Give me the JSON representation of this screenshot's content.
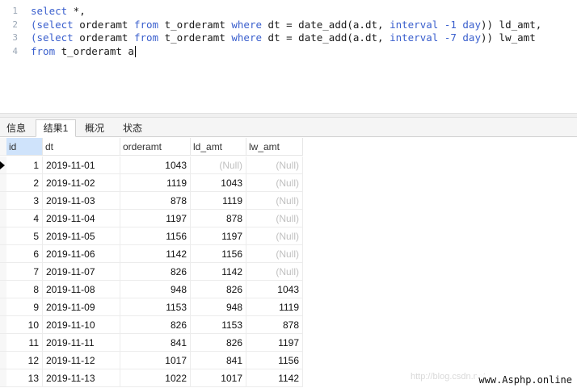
{
  "editor": {
    "line_numbers": [
      "1",
      "2",
      "3",
      "4"
    ],
    "lines": [
      [
        {
          "t": "select",
          "k": true
        },
        {
          "t": " *,",
          "k": false
        }
      ],
      [
        {
          "t": "(select",
          "k": true
        },
        {
          "t": " orderamt ",
          "k": false
        },
        {
          "t": "from",
          "k": true
        },
        {
          "t": " t_orderamt ",
          "k": false
        },
        {
          "t": "where",
          "k": true
        },
        {
          "t": " dt = date_add(a.dt, ",
          "k": false
        },
        {
          "t": "interval",
          "k": true
        },
        {
          "t": " ",
          "k": false
        },
        {
          "t": "-1",
          "k": true
        },
        {
          "t": " ",
          "k": false
        },
        {
          "t": "day",
          "k": true
        },
        {
          "t": ")) ld_amt,",
          "k": false
        }
      ],
      [
        {
          "t": "(select",
          "k": true
        },
        {
          "t": " orderamt ",
          "k": false
        },
        {
          "t": "from",
          "k": true
        },
        {
          "t": " t_orderamt ",
          "k": false
        },
        {
          "t": "where",
          "k": true
        },
        {
          "t": " dt = date_add(a.dt, ",
          "k": false
        },
        {
          "t": "interval",
          "k": true
        },
        {
          "t": " ",
          "k": false
        },
        {
          "t": "-7",
          "k": true
        },
        {
          "t": " ",
          "k": false
        },
        {
          "t": "day",
          "k": true
        },
        {
          "t": ")) lw_amt",
          "k": false
        }
      ],
      [
        {
          "t": "from",
          "k": true
        },
        {
          "t": " t_orderamt a",
          "k": false
        }
      ]
    ]
  },
  "tabs": [
    {
      "label": "信息",
      "active": false
    },
    {
      "label": "结果1",
      "active": true
    },
    {
      "label": "概况",
      "active": false
    },
    {
      "label": "状态",
      "active": false
    }
  ],
  "grid": {
    "columns": [
      "id",
      "dt",
      "orderamt",
      "ld_amt",
      "lw_amt"
    ],
    "selected_column": "id",
    "current_row": 0,
    "rows": [
      [
        "1",
        "2019-11-01",
        "1043",
        "(Null)",
        "(Null)"
      ],
      [
        "2",
        "2019-11-02",
        "1119",
        "1043",
        "(Null)"
      ],
      [
        "3",
        "2019-11-03",
        "878",
        "1119",
        "(Null)"
      ],
      [
        "4",
        "2019-11-04",
        "1197",
        "878",
        "(Null)"
      ],
      [
        "5",
        "2019-11-05",
        "1156",
        "1197",
        "(Null)"
      ],
      [
        "6",
        "2019-11-06",
        "1142",
        "1156",
        "(Null)"
      ],
      [
        "7",
        "2019-11-07",
        "826",
        "1142",
        "(Null)"
      ],
      [
        "8",
        "2019-11-08",
        "948",
        "826",
        "1043"
      ],
      [
        "9",
        "2019-11-09",
        "1153",
        "948",
        "1119"
      ],
      [
        "10",
        "2019-11-10",
        "826",
        "1153",
        "878"
      ],
      [
        "11",
        "2019-11-11",
        "841",
        "826",
        "1197"
      ],
      [
        "12",
        "2019-11-12",
        "1017",
        "841",
        "1156"
      ],
      [
        "13",
        "2019-11-13",
        "1022",
        "1017",
        "1142"
      ]
    ]
  },
  "watermark": {
    "text": "www.Asphp.online",
    "faint_text": "http://blog.csdn.net"
  },
  "colors": {
    "keyword": "#3a5fcd",
    "null_text": "#c0c0c0",
    "selected_header": "#cfe3fb"
  }
}
